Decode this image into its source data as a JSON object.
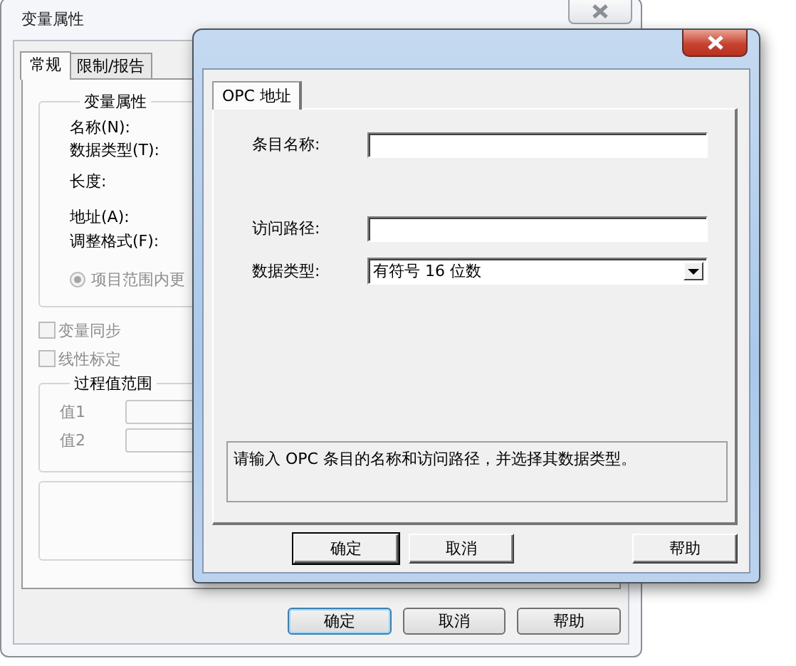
{
  "back_window": {
    "title": "变量属性",
    "tabs": [
      {
        "label": "常规",
        "selected": true
      },
      {
        "label": "限制/报告",
        "selected": false
      }
    ],
    "properties_group": {
      "title": "变量属性",
      "labels": [
        "名称(N):",
        "数据类型(T):",
        "长度:",
        "地址(A):",
        "调整格式(F):"
      ],
      "radio": {
        "label": "项目范围内更",
        "selected": true,
        "disabled": true
      }
    },
    "checkboxes": [
      {
        "label": "变量同步",
        "checked": false,
        "disabled": true
      },
      {
        "label": "线性标定",
        "checked": false,
        "disabled": true
      }
    ],
    "range_group": {
      "title": "过程值范围",
      "disabled": true,
      "fields": [
        {
          "label": "值1"
        },
        {
          "label": "值2"
        }
      ]
    },
    "buttons": [
      {
        "label": "确定",
        "default": true
      },
      {
        "label": "取消",
        "default": false
      },
      {
        "label": "帮助",
        "default": false
      }
    ]
  },
  "front_window": {
    "tabs": [
      {
        "label": "OPC 地址",
        "selected": true
      }
    ],
    "fields": [
      {
        "label": "条目名称:",
        "kind": "text"
      },
      {
        "label": "访问路径:",
        "kind": "text"
      },
      {
        "label": "数据类型:",
        "kind": "select",
        "value": "有符号 16 位数"
      }
    ],
    "description": "请输入 OPC 条目的名称和访问路径，并选择其数据类型。",
    "buttons": [
      {
        "label": "确定",
        "default": true
      },
      {
        "label": "取消",
        "default": false
      },
      {
        "label": "帮助",
        "default": false
      }
    ]
  }
}
